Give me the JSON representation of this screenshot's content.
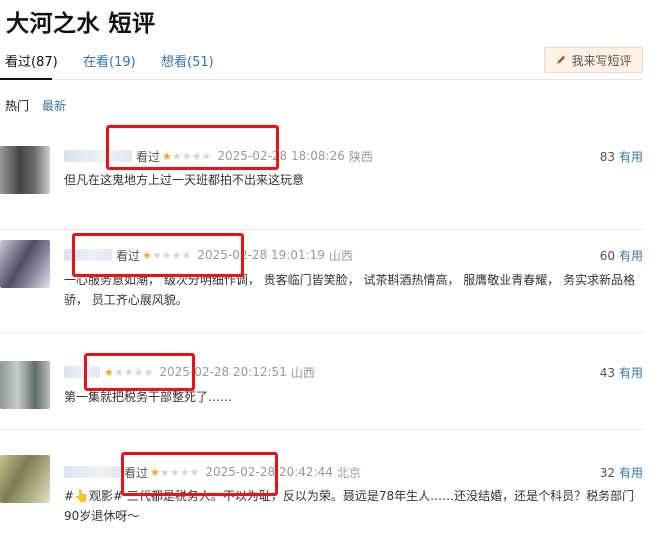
{
  "page": {
    "title": "大河之水 短评"
  },
  "tabs": [
    {
      "label": "看过(87)",
      "active": true
    },
    {
      "label": "在看(19)",
      "active": false
    },
    {
      "label": "想看(51)",
      "active": false
    }
  ],
  "write_button": {
    "label": "我来写短评",
    "icon": "pencil-icon"
  },
  "sort": {
    "hot": "热门",
    "new": "最新"
  },
  "comments": [
    {
      "status": "看过",
      "rating": 1,
      "time": "2025-02-28 18:08:26",
      "location": "陕西",
      "votes": "83",
      "vote_label": "有用",
      "text": "但凡在这鬼地方上过一天班都拍不出来这玩意"
    },
    {
      "status": "看过",
      "rating": 1,
      "time": "2025-02-28 19:01:19",
      "location": "山西",
      "votes": "60",
      "vote_label": "有用",
      "text": "一心服务意如潮， 级次分明细作调， 贵客临门皆笑脸， 试茶斟酒热情高， 服膺敬业青春耀， 务实求新品格骄， 员工齐心展风貌。"
    },
    {
      "status": "",
      "rating": 1,
      "time": "2025-02-28 20:12:51",
      "location": "山西",
      "votes": "43",
      "vote_label": "有用",
      "text": "第一集就把税务干部整死了……"
    },
    {
      "status": "看过",
      "rating": 1,
      "time": "2025-02-28 20:42:44",
      "location": "北京",
      "votes": "32",
      "vote_label": "有用",
      "text": "#👆观影# 三代都是税务人。不以为耻，反以为荣。聂远是78年生人……还没结婚，还是个科员？税务部门90岁退休呀～"
    }
  ],
  "colors": {
    "link": "#3377aa",
    "star": "#f5a623",
    "highlight": "#e8141c",
    "button_bg": "#fff1e6"
  }
}
